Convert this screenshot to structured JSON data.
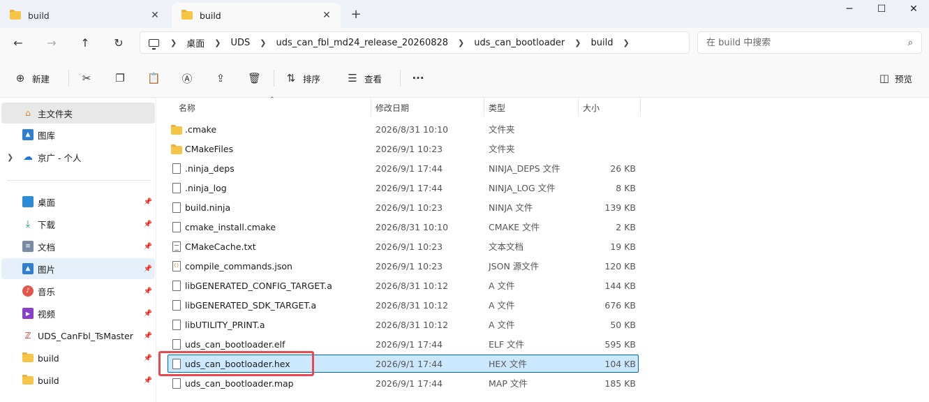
{
  "tabs": [
    {
      "label": "build",
      "active": false
    },
    {
      "label": "build",
      "active": true
    }
  ],
  "window_controls": {
    "minimize": "─",
    "maximize": "☐",
    "close": "✕"
  },
  "address": {
    "crumbs": [
      "桌面",
      "UDS",
      "uds_can_fbl_md24_release_20260828",
      "uds_can_bootloader",
      "build"
    ]
  },
  "search": {
    "placeholder": "在 build 中搜索"
  },
  "commands": {
    "new": "新建",
    "sort": "排序",
    "view": "查看",
    "more": "···",
    "preview": "预览"
  },
  "sidebar": {
    "top": [
      {
        "label": "主文件夹",
        "icon": "home-icon"
      },
      {
        "label": "图库",
        "icon": "gallery-icon"
      },
      {
        "label": "京广 - 个人",
        "icon": "cloud-icon"
      }
    ],
    "pinned": [
      {
        "label": "桌面",
        "icon": "desktop-icon"
      },
      {
        "label": "下载",
        "icon": "download-icon"
      },
      {
        "label": "文档",
        "icon": "document-icon"
      },
      {
        "label": "图片",
        "icon": "pictures-icon"
      },
      {
        "label": "音乐",
        "icon": "music-icon"
      },
      {
        "label": "视频",
        "icon": "video-icon"
      },
      {
        "label": "UDS_CanFbl_TsMaster",
        "icon": "app-folder-icon"
      },
      {
        "label": "build",
        "icon": "folder-icon"
      },
      {
        "label": "build",
        "icon": "folder-icon"
      }
    ]
  },
  "columns": {
    "name": "名称",
    "date": "修改日期",
    "type": "类型",
    "size": "大小"
  },
  "files": [
    {
      "name": ".cmake",
      "date": "2026/8/31 10:10",
      "type": "文件夹",
      "size": "",
      "kind": "folder"
    },
    {
      "name": "CMakeFiles",
      "date": "2026/9/1 10:23",
      "type": "文件夹",
      "size": "",
      "kind": "folder"
    },
    {
      "name": ".ninja_deps",
      "date": "2026/9/1 17:44",
      "type": "NINJA_DEPS 文件",
      "size": "26 KB",
      "kind": "file"
    },
    {
      "name": ".ninja_log",
      "date": "2026/9/1 17:44",
      "type": "NINJA_LOG 文件",
      "size": "8 KB",
      "kind": "file"
    },
    {
      "name": "build.ninja",
      "date": "2026/9/1 10:23",
      "type": "NINJA 文件",
      "size": "139 KB",
      "kind": "file"
    },
    {
      "name": "cmake_install.cmake",
      "date": "2026/8/31 10:10",
      "type": "CMAKE 文件",
      "size": "2 KB",
      "kind": "file"
    },
    {
      "name": "CMakeCache.txt",
      "date": "2026/9/1 10:23",
      "type": "文本文档",
      "size": "19 KB",
      "kind": "txt"
    },
    {
      "name": "compile_commands.json",
      "date": "2026/9/1 10:23",
      "type": "JSON 源文件",
      "size": "120 KB",
      "kind": "json"
    },
    {
      "name": "libGENERATED_CONFIG_TARGET.a",
      "date": "2026/8/31 10:12",
      "type": "A 文件",
      "size": "144 KB",
      "kind": "file"
    },
    {
      "name": "libGENERATED_SDK_TARGET.a",
      "date": "2026/8/31 10:12",
      "type": "A 文件",
      "size": "676 KB",
      "kind": "file"
    },
    {
      "name": "libUTILITY_PRINT.a",
      "date": "2026/8/31 10:12",
      "type": "A 文件",
      "size": "50 KB",
      "kind": "file"
    },
    {
      "name": "uds_can_bootloader.elf",
      "date": "2026/9/1 17:44",
      "type": "ELF 文件",
      "size": "595 KB",
      "kind": "file"
    },
    {
      "name": "uds_can_bootloader.hex",
      "date": "2026/9/1 17:44",
      "type": "HEX 文件",
      "size": "104 KB",
      "kind": "file",
      "selected": true
    },
    {
      "name": "uds_can_bootloader.map",
      "date": "2026/9/1 17:44",
      "type": "MAP 文件",
      "size": "185 KB",
      "kind": "file"
    }
  ],
  "colors": {
    "accent": "#0067c0",
    "selection": "#cce8ff",
    "annotation": "#e8484f",
    "folder": "#f7c546"
  }
}
